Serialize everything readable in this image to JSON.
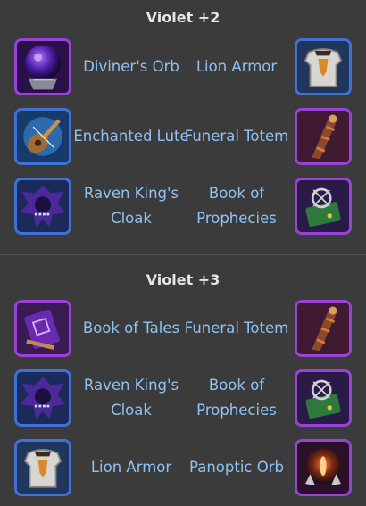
{
  "sections": [
    {
      "title": "Violet +2",
      "rows": [
        {
          "left": {
            "name": "Diviner's Orb",
            "icon": "diviners-orb-icon"
          },
          "right": {
            "name": "Lion Armor",
            "icon": "lion-armor-icon"
          }
        },
        {
          "left": {
            "name": "Enchanted Lute",
            "icon": "enchanted-lute-icon"
          },
          "right": {
            "name": "Funeral Totem",
            "icon": "funeral-totem-icon"
          }
        },
        {
          "left": {
            "name": "Raven King's Cloak",
            "icon": "raven-kings-cloak-icon"
          },
          "right": {
            "name": "Book of Prophecies",
            "icon": "book-of-prophecies-icon"
          }
        }
      ]
    },
    {
      "title": "Violet +3",
      "rows": [
        {
          "left": {
            "name": "Book of Tales",
            "icon": "book-of-tales-icon"
          },
          "right": {
            "name": "Funeral Totem",
            "icon": "funeral-totem-icon"
          }
        },
        {
          "left": {
            "name": "Raven King's Cloak",
            "icon": "raven-kings-cloak-icon"
          },
          "right": {
            "name": "Book of Prophecies",
            "icon": "book-of-prophecies-icon"
          }
        },
        {
          "left": {
            "name": "Lion Armor",
            "icon": "lion-armor-icon"
          },
          "right": {
            "name": "Panoptic Orb",
            "icon": "panoptic-orb-icon"
          }
        }
      ]
    }
  ],
  "colors": {
    "background": "#3b3b3b",
    "title": "#e6e6e6",
    "item_name": "#8fc2f2",
    "frame_violet": "#9a42d8",
    "frame_blue": "#3f72d6"
  }
}
